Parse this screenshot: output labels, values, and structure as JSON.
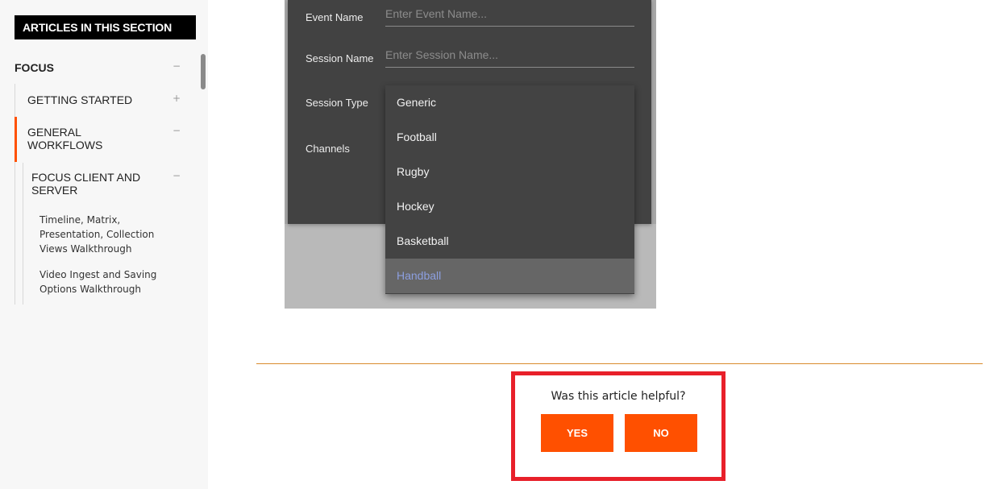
{
  "sidebar": {
    "section_title": "ARTICLES IN THIS SECTION",
    "focus": {
      "label": "FOCUS",
      "toggle": "−"
    },
    "getting_started": {
      "label": "GETTING STARTED",
      "toggle": "+"
    },
    "general_workflows": {
      "line1": "GENERAL",
      "line2": "WORKFLOWS",
      "toggle": "−"
    },
    "focus_client_server": {
      "line1": "FOCUS CLIENT AND",
      "line2": "SERVER",
      "toggle": "−"
    },
    "articles": [
      {
        "lines": [
          "Timeline, Matrix,",
          "Presentation, Collection",
          "Views Walkthrough"
        ]
      },
      {
        "lines": [
          "Video Ingest and Saving",
          "Options Walkthrough"
        ]
      }
    ]
  },
  "dialog": {
    "event_name": {
      "label": "Event Name",
      "placeholder": "Enter Event Name..."
    },
    "session_name": {
      "label": "Session Name",
      "placeholder": "Enter Session Name..."
    },
    "session_type": {
      "label": "Session Type"
    },
    "channels": {
      "label": "Channels"
    },
    "dropdown": {
      "options": [
        "Generic",
        "Football",
        "Rugby",
        "Hockey",
        "Basketball",
        "Handball"
      ],
      "selected": "Handball"
    }
  },
  "feedback": {
    "question": "Was this article helpful?",
    "yes": "YES",
    "no": "NO"
  },
  "colors": {
    "accent": "#ff5000",
    "highlight_border": "#e8202a",
    "divider": "#d98a2c",
    "selected_option_text": "#8c9fe0"
  }
}
